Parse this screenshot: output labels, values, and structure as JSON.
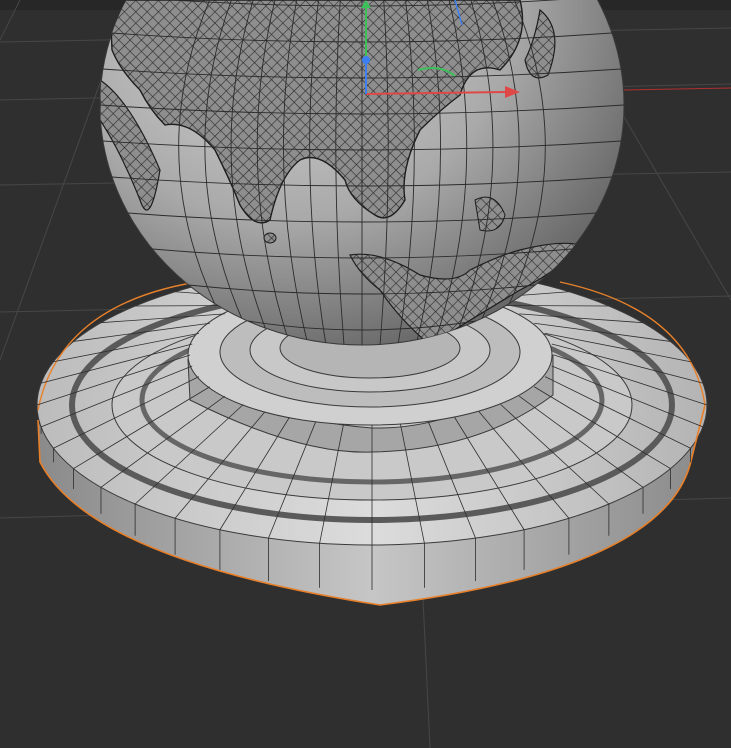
{
  "viewport": {
    "title": "",
    "background": "#2f2f2f",
    "grid_color": "#4a4a4a",
    "selection_outline_color": "#e8802a",
    "gizmo_colors": {
      "x": "#e04848",
      "y": "#3cc05a",
      "z": "#3b7ff0",
      "rotate": "#3cc05a"
    },
    "objects": {
      "globe": "globe-mesh",
      "stand": "stand-base-mesh"
    }
  }
}
